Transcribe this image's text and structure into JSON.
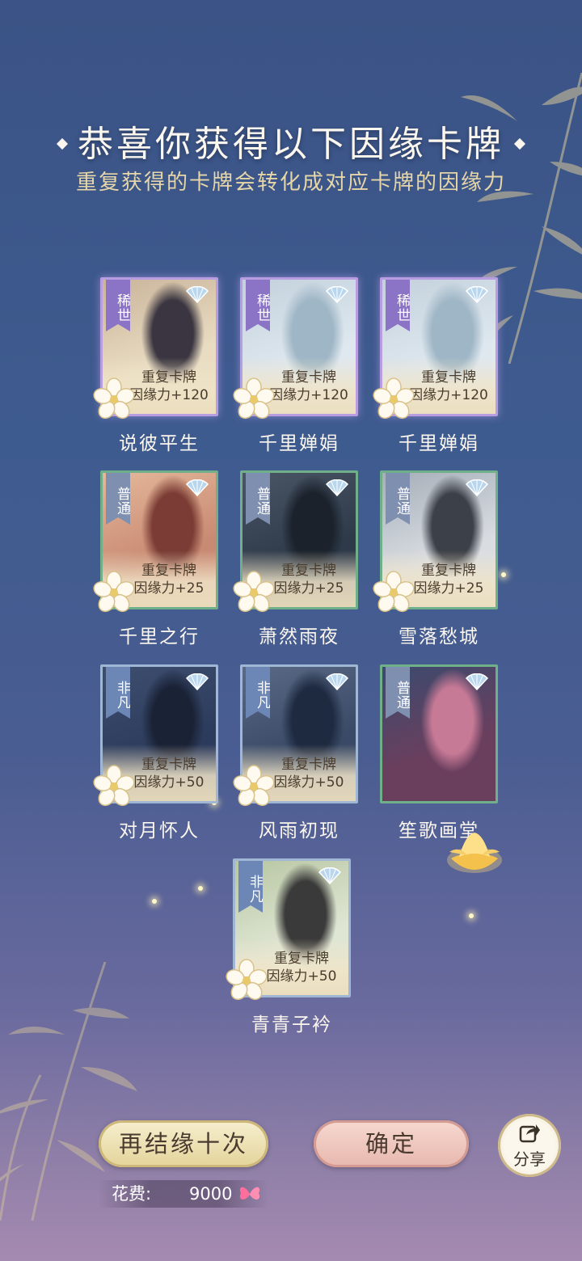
{
  "header": {
    "title": "恭喜你获得以下因缘卡牌",
    "subtitle": "重复获得的卡牌会转化成对应卡牌的因缘力"
  },
  "cards": [
    {
      "rarity": "稀世",
      "name": "说彼平生",
      "line1": "重复卡牌",
      "line2": "因缘力+120"
    },
    {
      "rarity": "稀世",
      "name": "千里婵娟",
      "line1": "重复卡牌",
      "line2": "因缘力+120"
    },
    {
      "rarity": "稀世",
      "name": "千里婵娟",
      "line1": "重复卡牌",
      "line2": "因缘力+120"
    },
    {
      "rarity": "普通",
      "name": "千里之行",
      "line1": "重复卡牌",
      "line2": "因缘力+25"
    },
    {
      "rarity": "普通",
      "name": "萧然雨夜",
      "line1": "重复卡牌",
      "line2": "因缘力+25"
    },
    {
      "rarity": "普通",
      "name": "雪落愁城",
      "line1": "重复卡牌",
      "line2": "因缘力+25"
    },
    {
      "rarity": "非凡",
      "name": "对月怀人",
      "line1": "重复卡牌",
      "line2": "因缘力+50"
    },
    {
      "rarity": "非凡",
      "name": "风雨初现",
      "line1": "重复卡牌",
      "line2": "因缘力+50"
    },
    {
      "rarity": "普通",
      "name": "笙歌画堂",
      "line1": "",
      "line2": ""
    },
    {
      "rarity": "非凡",
      "name": "青青子衿",
      "line1": "重复卡牌",
      "line2": "因缘力+50"
    }
  ],
  "buttons": {
    "again": "再结缘十次",
    "confirm": "确定",
    "share": "分享"
  },
  "cost": {
    "label": "花费:",
    "value": "9000"
  },
  "colors": {
    "rare": "#8b73c6",
    "common": "#7f8fb0",
    "uncommon": "#6c86b6",
    "gold_text": "#e6d6a8"
  }
}
